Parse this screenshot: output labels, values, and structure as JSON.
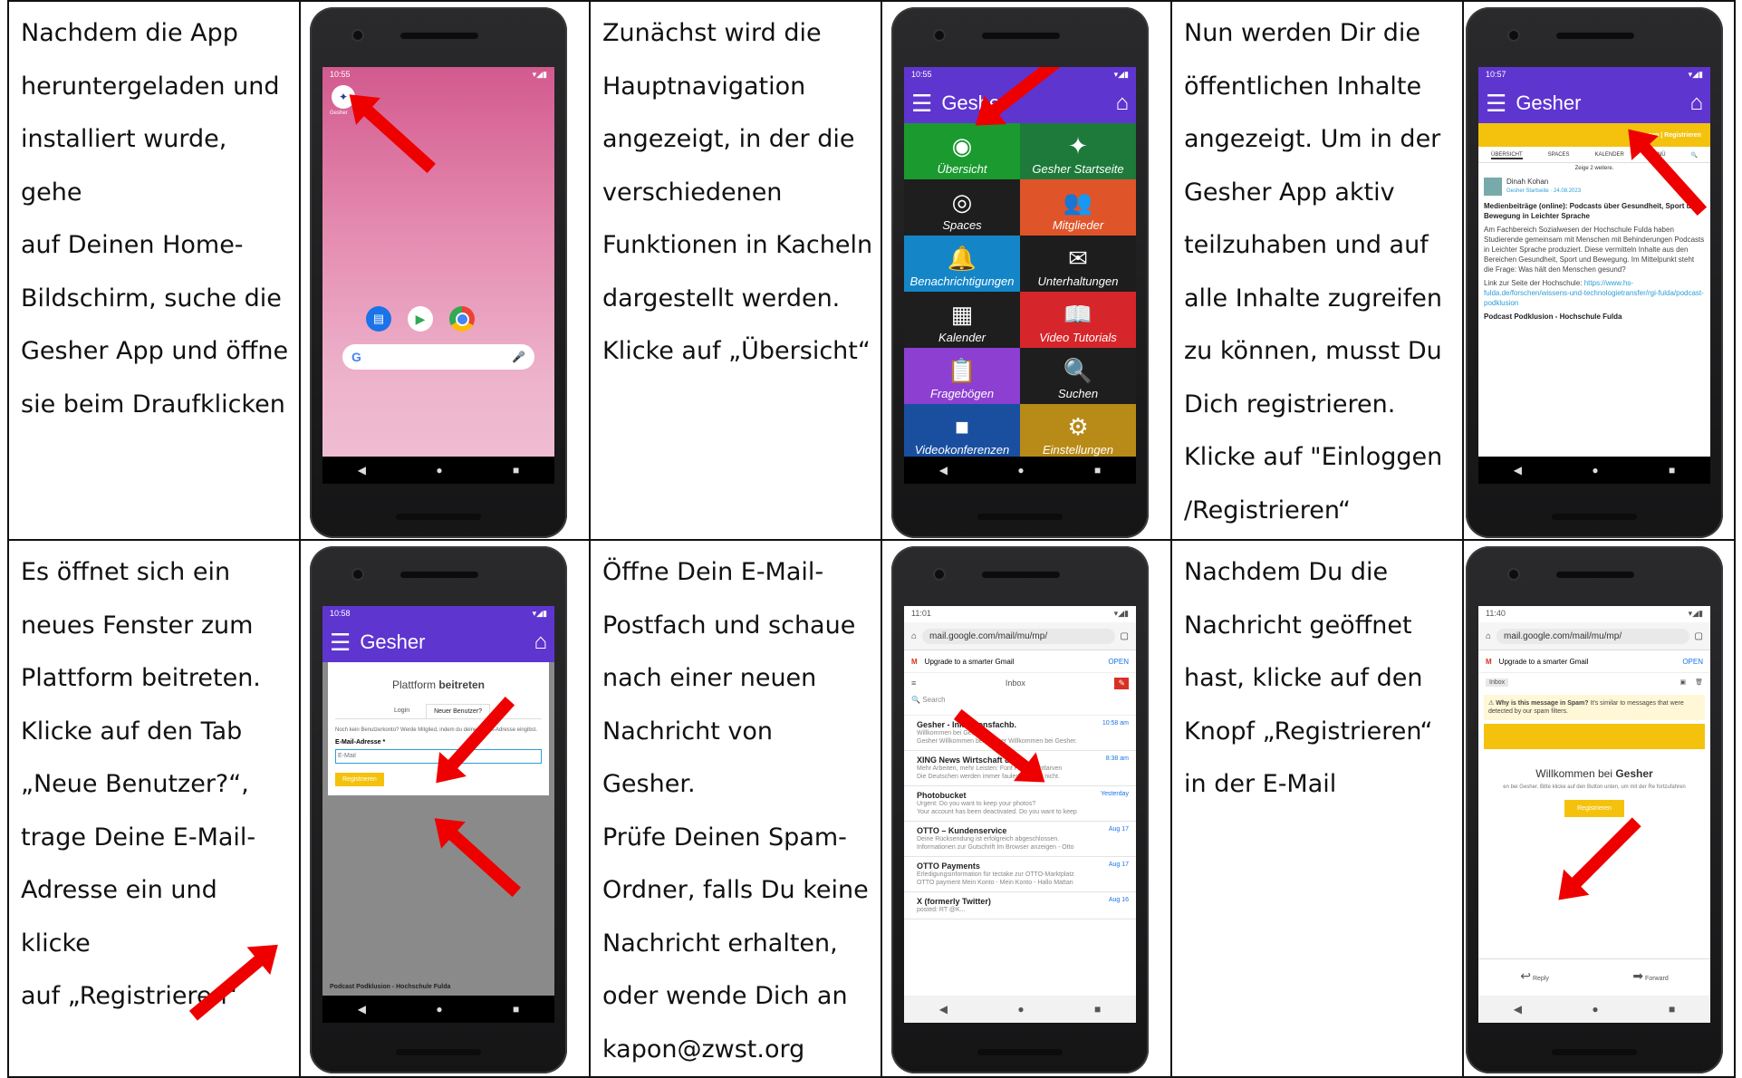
{
  "steps": [
    {
      "lines": [
        "Nachdem die App",
        "heruntergeladen und",
        "installiert wurde, gehe",
        "auf Deinen Home-",
        "Bildschirm, suche die",
        "Gesher App und öffne",
        "sie beim Draufklicken"
      ],
      "screen": {
        "time": "10:55",
        "app_label": "Gesher"
      }
    },
    {
      "lines": [
        "Zunächst wird die",
        "Hauptnavigation",
        "angezeigt, in der die",
        "verschiedenen",
        "Funktionen in Kacheln",
        "dargestellt werden.",
        "Klicke auf „Übersicht“"
      ],
      "screen": {
        "time": "10:55",
        "title": "Gesher",
        "tiles": [
          {
            "label": "Übersicht",
            "color": "#1a9a2f",
            "icon": "eye-icon",
            "glyph": "◉"
          },
          {
            "label": "Gesher Startseite",
            "color": "#1d7a3a",
            "icon": "logo-icon",
            "glyph": "✦"
          },
          {
            "label": "Spaces",
            "color": "#1e1e1e",
            "icon": "target-icon",
            "glyph": "◎"
          },
          {
            "label": "Mitglieder",
            "color": "#e0542a",
            "icon": "people-icon",
            "glyph": "👥"
          },
          {
            "label": "Benachrichtigungen",
            "color": "#1486c8",
            "icon": "bell-icon",
            "glyph": "🔔"
          },
          {
            "label": "Unterhaltungen",
            "color": "#1d1d1d",
            "icon": "envelope-icon",
            "glyph": "✉"
          },
          {
            "label": "Kalender",
            "color": "#1e1e1e",
            "icon": "calendar-icon",
            "glyph": "▦"
          },
          {
            "label": "Video Tutorials",
            "color": "#d6262b",
            "icon": "book-icon",
            "glyph": "📖"
          },
          {
            "label": "Fragebögen",
            "color": "#8c3fd1",
            "icon": "clipboard-icon",
            "glyph": "📋"
          },
          {
            "label": "Suchen",
            "color": "#1e1e1e",
            "icon": "search-icon",
            "glyph": "🔍"
          },
          {
            "label": "Videokonferenzen",
            "color": "#1a4fa0",
            "icon": "video-icon",
            "glyph": "■"
          },
          {
            "label": "Einstellungen",
            "color": "#b88a17",
            "icon": "gear-icon",
            "glyph": "⚙"
          }
        ]
      }
    },
    {
      "lines": [
        "Nun werden Dir die",
        "öffentlichen Inhalte",
        "angezeigt. Um in der",
        "Gesher App aktiv",
        "teilzuhaben und auf",
        "alle Inhalte zugreifen",
        "zu können, musst Du",
        "Dich registrieren.",
        "Klicke auf \"Einloggen",
        "/Registrieren“"
      ],
      "screen": {
        "time": "10:57",
        "title": "Gesher",
        "login_label": "Einloggen | Registrieren",
        "tabs": [
          "ÜBERSICHT",
          "SPACES",
          "KALENDER",
          "MENÜ"
        ],
        "more_label": "Zeige 2 weitere.",
        "author": "Dinah Kohan",
        "meta": "Gesher Startseite · 24.08.2023",
        "headline": "Medienbeiträge (online): Podcasts über Gesundheit, Sport und Bewegung in Leichter Sprache",
        "body": "Am Fachbereich Sozialwesen der Hochschule Fulda haben Studierende gemeinsam mit Menschen mit Behinderungen Podcasts in Leichter Sprache produziert. Diese vermitteln Inhalte aus den Bereichen Gesundheit, Sport und Bewegung. Im Mittelpunkt steht die Frage: Was hält den Menschen gesund?",
        "link_label": "Link zur Seite der Hochschule:",
        "link": "https://www.hs-fulda.de/forschen/wissens-und-technologietransfer/rgi-fulda/podcast-podklusion",
        "footer": "Podcast Podklusion - Hochschule Fulda"
      }
    },
    {
      "lines": [
        "Es öffnet sich ein",
        "neues Fenster zum",
        "Plattform beitreten.",
        "Klicke auf den Tab",
        "„Neue Benutzer?“,",
        "trage Deine E-Mail-",
        "Adresse ein und klicke",
        "auf „Registrieren“"
      ],
      "screen": {
        "time": "10:58",
        "title": "Gesher",
        "dialog_title_pre": "Plattform",
        "dialog_title_bold": "beitreten",
        "tab_login": "Login",
        "tab_new": "Neuer Benutzer?",
        "hint": "Noch kein Benutzerkonto? Werde Mitglied, indem du deine E-Mail-Adresse eingibst.",
        "email_label": "E-Mail-Adresse *",
        "email_placeholder": "E-Mail",
        "register_label": "Registrieren",
        "footer": "Podcast Podklusion - Hochschule Fulda"
      }
    },
    {
      "lines": [
        "Öffne Dein E-Mail-",
        "Postfach und schaue",
        "nach einer neuen",
        "Nachricht von Gesher.",
        "Prüfe Deinen Spam-",
        "Ordner, falls Du keine",
        "Nachricht erhalten,",
        "oder wende Dich an",
        "kapon@zwst.org"
      ],
      "screen": {
        "time": "11:01",
        "url": "mail.google.com/mail/mu/mp/",
        "upgrade": "Upgrade to a smarter Gmail",
        "open": "OPEN",
        "inbox": "Inbox",
        "search": "Search",
        "mails": [
          {
            "sender": "Gesher - Inklusionsfachb.",
            "time": "10:58 am",
            "subject": "Willkommen bei Gesher",
            "snippet": "Gesher Willkommen bei Gesher Willkommen bei Gesher."
          },
          {
            "sender": "XING News Wirtschaft & M.",
            "time": "8:38 am",
            "subject": "Mehr Arbeiten, mehr Leisten: Fünf Punkte entlarven",
            "snippet": "Die Deutschen werden immer fauler? Stimmt nicht."
          },
          {
            "sender": "Photobucket",
            "time": "Yesterday",
            "subject": "Urgent: Do you want to keep your photos?",
            "snippet": "Your account has been deactivated. Do you want to keep"
          },
          {
            "sender": "OTTO – Kundenservice",
            "time": "Aug 17",
            "subject": "Deine Rücksendung ist erfolgreich abgeschlossen.",
            "snippet": "Informationen zur Gutschrift Im Browser anzeigen - Otto"
          },
          {
            "sender": "OTTO Payments",
            "time": "Aug 17",
            "subject": "Erledigungsinformation für tectake zur OTTO-Marktplatz",
            "snippet": "OTTO payment Mein Konto - Mein Konto - Hallo Mattan"
          },
          {
            "sender": "X (formerly Twitter)",
            "time": "Aug 16",
            "subject": "posted: RT @K...",
            "snippet": ""
          }
        ]
      }
    },
    {
      "lines": [
        "Nachdem Du die",
        "Nachricht geöffnet",
        "hast, klicke auf den",
        "Knopf „Registrieren“",
        "in der E-Mail"
      ],
      "screen": {
        "time": "11:40",
        "url": "mail.google.com/mail/mu/mp/",
        "upgrade": "Upgrade to a smarter Gmail",
        "open": "OPEN",
        "inbox": "Inbox",
        "spam_bold": "Why is this message in Spam?",
        "spam_text": "It's similar to messages that were detected by our spam filters.",
        "welcome_pre": "Willkommen bei",
        "welcome_bold": "Gesher",
        "welcome_text": "en bei Gesher. Bitte klicke auf den Button unten, um mit der Re fortzufahren",
        "register_label": "Registrieren",
        "reply": "Reply",
        "forward": "Forward"
      }
    }
  ]
}
